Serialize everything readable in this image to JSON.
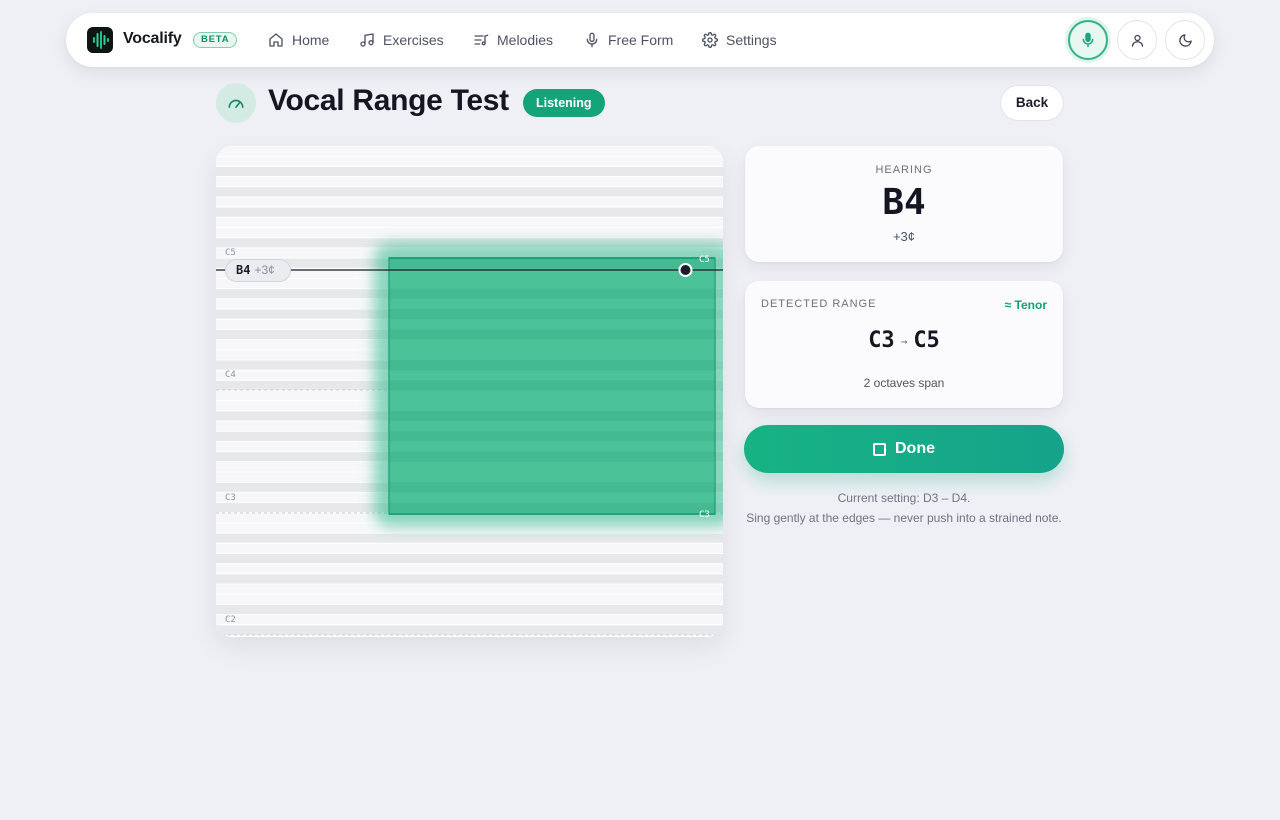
{
  "nav": {
    "brand": "Vocalify",
    "badge": "BETA",
    "items": [
      {
        "label": "Home",
        "icon": "home-icon"
      },
      {
        "label": "Exercises",
        "icon": "music-note-icon"
      },
      {
        "label": "Melodies",
        "icon": "playlist-icon"
      },
      {
        "label": "Free Form",
        "icon": "microphone-icon"
      },
      {
        "label": "Settings",
        "icon": "gear-icon"
      }
    ],
    "actions": [
      "microphone-icon",
      "user-icon",
      "moon-icon"
    ]
  },
  "header": {
    "title": "Vocal Range Test",
    "status": "Listening",
    "back_label": "Back",
    "icon": "gauge-icon"
  },
  "visualizer": {
    "current_note": "B4",
    "current_cents": "+3¢",
    "octave_labels": [
      "C5",
      "C4",
      "C3",
      "C2"
    ],
    "range_top_label": "C5",
    "range_bottom_label": "C3"
  },
  "hearing": {
    "label": "HEARING",
    "note": "B4",
    "cents": "+3¢"
  },
  "detected": {
    "label": "DETECTED RANGE",
    "voice_type": "≈ Tenor",
    "low": "C3",
    "high": "C5",
    "span": "2 octaves span"
  },
  "done_label": "Done",
  "hint": {
    "line1": "Current setting: D3 – D4.",
    "line2": "Sing gently at the edges — never push into a strained note."
  },
  "colors": {
    "accent": "#14a47a",
    "background": "#eff0f5"
  }
}
